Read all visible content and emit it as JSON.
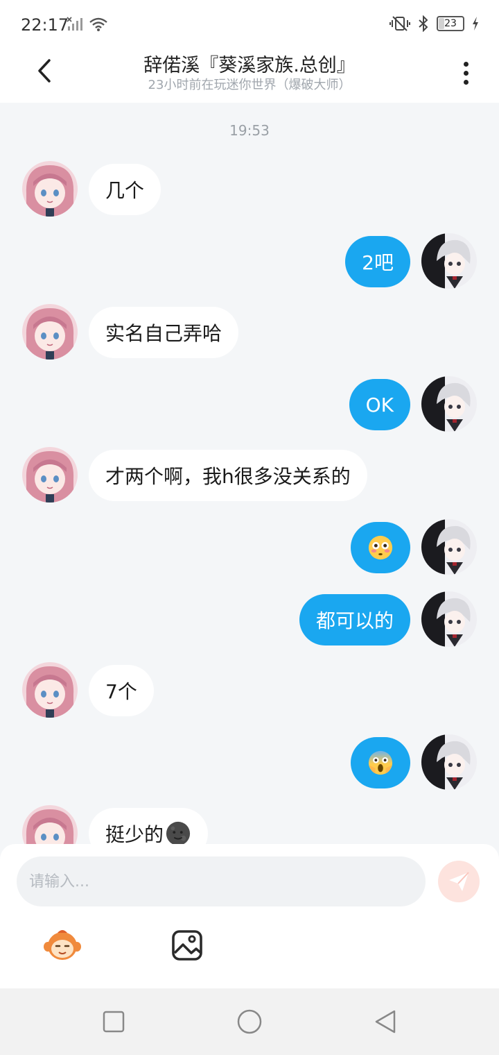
{
  "status_bar": {
    "time": "22:17",
    "battery_level": "23"
  },
  "header": {
    "title": "辞偌溪『葵溪家族.总创』",
    "subtitle": "23小时前在玩迷你世界（爆破大师）"
  },
  "chat": {
    "timestamp": "19:53",
    "messages": [
      {
        "side": "left",
        "text": "几个"
      },
      {
        "side": "right",
        "text": "2吧"
      },
      {
        "side": "left",
        "text": "实名自己弄哈"
      },
      {
        "side": "right",
        "text": "OK"
      },
      {
        "side": "left",
        "text": "才两个啊，我h很多没关系的"
      },
      {
        "side": "right",
        "emoji": "flushed-face-emoji"
      },
      {
        "side": "right",
        "text": "都可以的"
      },
      {
        "side": "left",
        "text": "7个"
      },
      {
        "side": "right",
        "emoji": "screaming-face-emoji"
      },
      {
        "side": "left",
        "text": "挺少的",
        "emoji": "dark-moon-face-emoji"
      }
    ]
  },
  "input": {
    "placeholder": "请输入..."
  },
  "icons": {
    "back": "chevron-left-icon",
    "more": "more-vertical-icon",
    "send": "send-icon",
    "sticker": "monkey-sticker-icon",
    "image": "image-icon",
    "nav_recents": "square-icon",
    "nav_home": "circle-icon",
    "nav_back": "triangle-back-icon"
  },
  "colors": {
    "outgoing_bubble": "#1aa7f0",
    "incoming_bubble": "#ffffff",
    "chat_background": "#f4f6f8",
    "send_button": "#fde3de"
  }
}
